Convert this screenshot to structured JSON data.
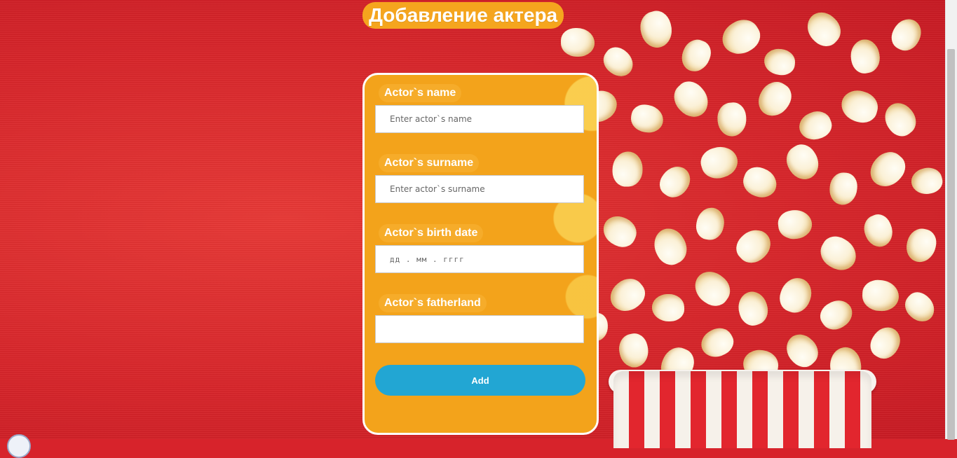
{
  "page": {
    "title": "Добавление актера"
  },
  "form": {
    "fields": [
      {
        "label": "Actor`s name",
        "placeholder": "Enter actor`s name",
        "value": ""
      },
      {
        "label": "Actor`s surname",
        "placeholder": "Enter actor`s surname",
        "value": ""
      },
      {
        "label": "Actor`s birth date",
        "placeholder": "дд . мм . гггг",
        "value": ""
      },
      {
        "label": "Actor`s fatherland",
        "placeholder": "",
        "value": ""
      }
    ],
    "submit_label": "Add"
  },
  "colors": {
    "background_red": "#d7232b",
    "card_orange": "#f3a31b",
    "button_blue": "#22a6d3",
    "text_white": "#ffffff"
  }
}
